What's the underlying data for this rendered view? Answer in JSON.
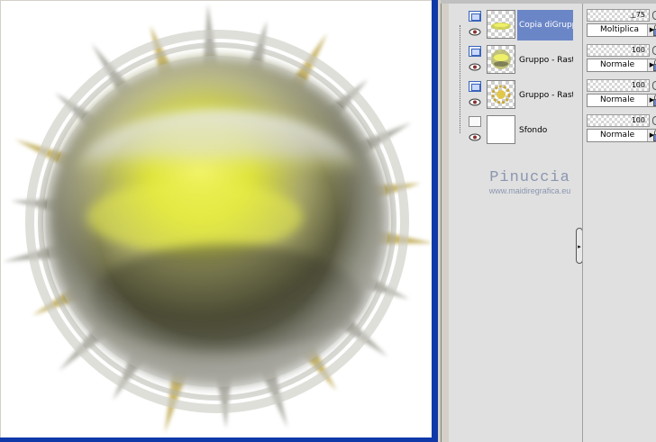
{
  "layers": [
    {
      "name": "Copia diGruppo",
      "selected": true,
      "type": "group",
      "thumbnail": "glow-orb-small",
      "opacity": "75",
      "blend_mode": "Moltiplica"
    },
    {
      "name": "Gruppo - Raster",
      "selected": false,
      "type": "group",
      "thumbnail": "glow-orb",
      "opacity": "100",
      "blend_mode": "Normale"
    },
    {
      "name": "Gruppo - Raster",
      "selected": false,
      "type": "group",
      "thumbnail": "yellow-pattern",
      "opacity": "100",
      "blend_mode": "Normale"
    },
    {
      "name": "Sfondo",
      "selected": false,
      "type": "background",
      "thumbnail": "white",
      "opacity": "100",
      "blend_mode": "Normale"
    }
  ],
  "watermark": {
    "name": "Pinuccia",
    "url": "www.maidiregrafica.eu"
  },
  "colors": {
    "canvas_border": "#0f39a8",
    "selected_layer": "#6b86c7",
    "panel_bg": "#e0e0e0",
    "orb_yellow": "#e0e63a",
    "orb_dark": "#3a3a22"
  },
  "icons": {
    "layer_group": "layer-group-icon",
    "layer_raster": "layer-raster-icon",
    "visibility": "eye-icon",
    "link": "link-icon",
    "lock": "lock-icon",
    "dropdown": "dropdown-arrow-icon"
  }
}
